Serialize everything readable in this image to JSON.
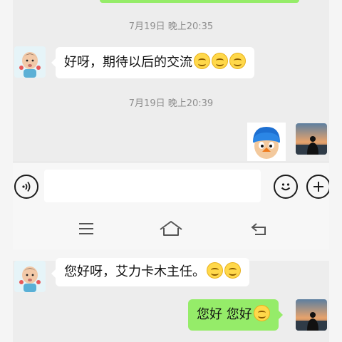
{
  "messages_top": {
    "time_1": "7月19日 晚上20:35",
    "msg_1_text": "好呀，期待以后的交流",
    "time_2": "7月19日 晚上20:39"
  },
  "messages_bottom": {
    "msg_2_text": "您好呀，艾力卡木主任。",
    "msg_3_text": "您好 您好"
  },
  "icons": {
    "voice": "voice-icon",
    "emoji_button": "emoji-icon",
    "more": "plus-icon",
    "nav_menu": "menu-icon",
    "nav_home": "home-icon",
    "nav_back": "back-icon",
    "emoji": "smile-emoji-icon"
  },
  "colors": {
    "background": "#ededed",
    "sent_bubble": "#95ec69",
    "received_bubble": "#ffffff",
    "timestamp_text": "#8e8e8e"
  }
}
